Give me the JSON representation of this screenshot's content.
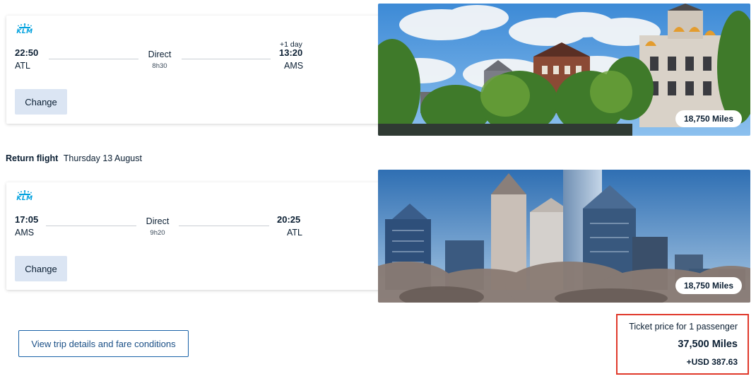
{
  "outbound": {
    "airline_logo_text": "KLM",
    "departure_time": "22:50",
    "departure_airport": "ATL",
    "stop_type": "Direct",
    "duration": "8h30",
    "day_offset": "+1 day",
    "arrival_time": "13:20",
    "arrival_airport": "AMS",
    "change_label": "Change",
    "destination_photo": "amsterdam-canal-houses",
    "miles": "18,750 Miles"
  },
  "return_heading": {
    "label": "Return flight",
    "date": "Thursday 13 August"
  },
  "return": {
    "airline_logo_text": "KLM",
    "departure_time": "17:05",
    "departure_airport": "AMS",
    "stop_type": "Direct",
    "duration": "9h20",
    "arrival_time": "20:25",
    "arrival_airport": "ATL",
    "change_label": "Change",
    "destination_photo": "atlanta-skyline",
    "miles": "18,750 Miles"
  },
  "trip_details_label": "View trip details and fare conditions",
  "price": {
    "caption": "Ticket price for 1 passenger",
    "miles": "37,500 Miles",
    "taxes": "+USD 387.63"
  },
  "colors": {
    "klm_blue": "#00a1de",
    "change_button_bg": "#dbe5f3",
    "link_blue": "#1a62a8",
    "highlight_red": "#e0392b"
  }
}
